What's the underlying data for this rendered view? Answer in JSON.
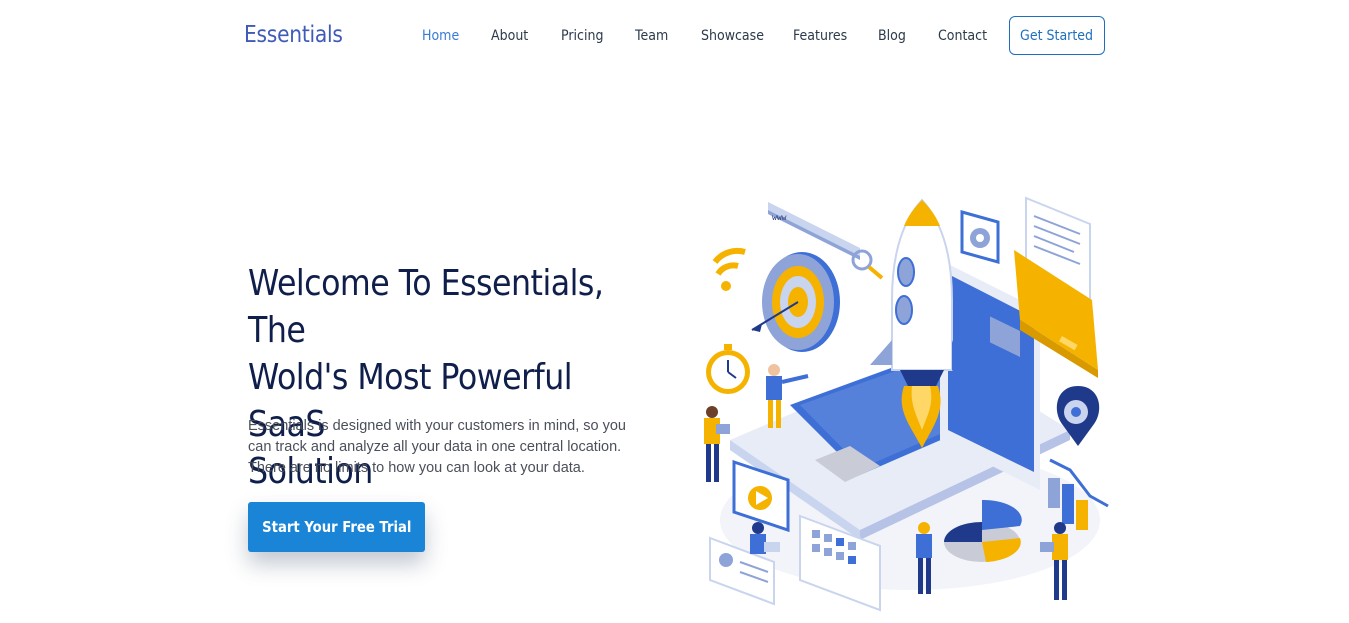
{
  "header": {
    "logo": "Essentials",
    "nav": [
      {
        "label": "Home",
        "active": true
      },
      {
        "label": "About",
        "active": false
      },
      {
        "label": "Pricing",
        "active": false
      },
      {
        "label": "Team",
        "active": false
      },
      {
        "label": "Showcase",
        "active": false
      },
      {
        "label": "Features",
        "active": false
      },
      {
        "label": "Blog",
        "active": false
      },
      {
        "label": "Contact",
        "active": false
      }
    ],
    "cta_label": "Get Started"
  },
  "hero": {
    "title_lines": [
      "Welcome To Essentials, The",
      "Wold's Most Powerful SaaS",
      "Solution"
    ],
    "description_lines": [
      "Essentials is designed with your customers in mind, so you",
      "can track and analyze all your data in one central location.",
      "There are no limits to how you can look at your data."
    ],
    "cta_label": "Start Your Free Trial",
    "illustration_url_text": "www"
  },
  "colors": {
    "brand": "#3f5bb7",
    "nav_active": "#3a7bd5",
    "title": "#0f1e4a",
    "primary_button": "#1a84d6",
    "illustration_blue": "#3d6fd6",
    "illustration_yellow": "#f5b300"
  }
}
